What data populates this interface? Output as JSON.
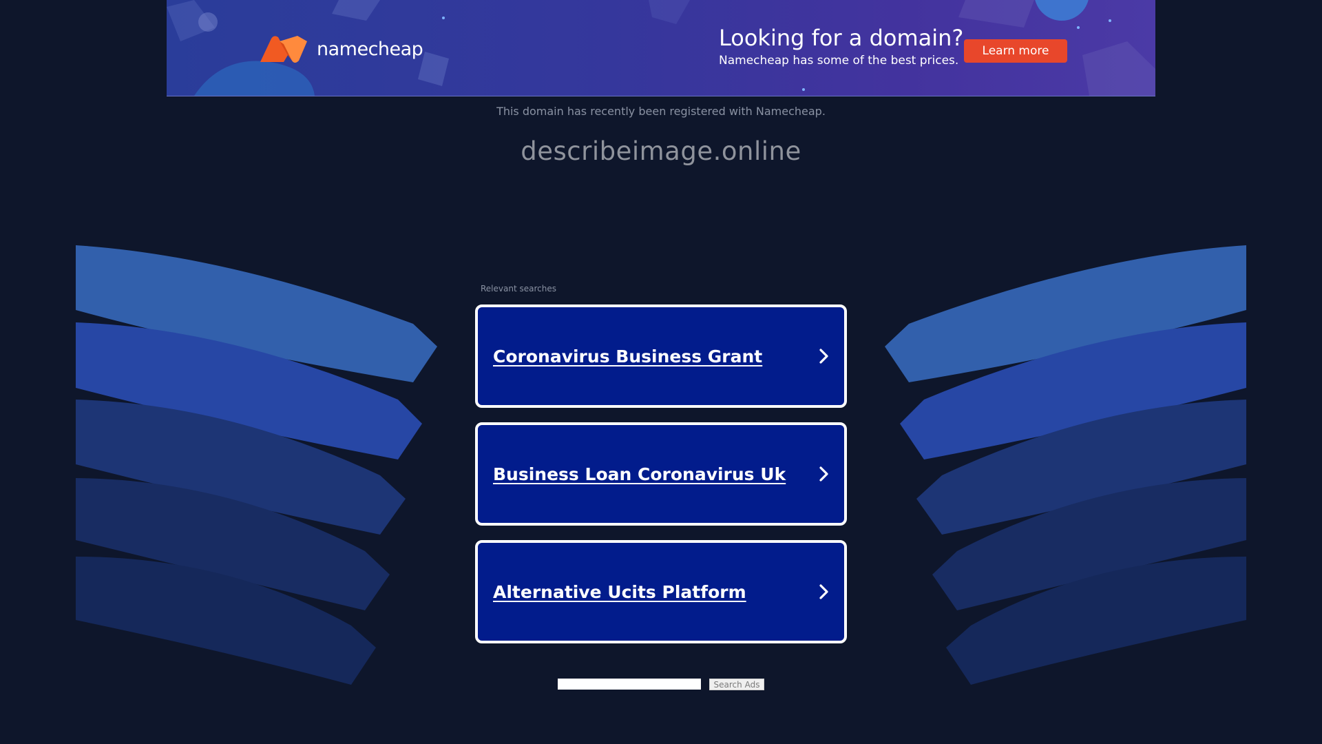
{
  "banner": {
    "brand": "namecheap",
    "headline": "Looking for a domain?",
    "subline": "Namecheap has some of the best prices.",
    "cta_label": "Learn more",
    "logo_icon": "namecheap-n-logo-icon",
    "colors": {
      "logo_orange": "#f15a22",
      "cta_red": "#e8472b"
    }
  },
  "page": {
    "registered_note": "This domain has recently been registered with Namecheap.",
    "domain": "describeimage.online"
  },
  "searches": {
    "heading": "Relevant searches",
    "items": [
      {
        "label": "Coronavirus Business Grant",
        "icon": "chevron-right-icon"
      },
      {
        "label": "Business Loan Coronavirus Uk",
        "icon": "chevron-right-icon"
      },
      {
        "label": "Alternative Ucits Platform",
        "icon": "chevron-right-icon"
      }
    ]
  },
  "search_box": {
    "value": "",
    "button_label": "Search Ads"
  }
}
